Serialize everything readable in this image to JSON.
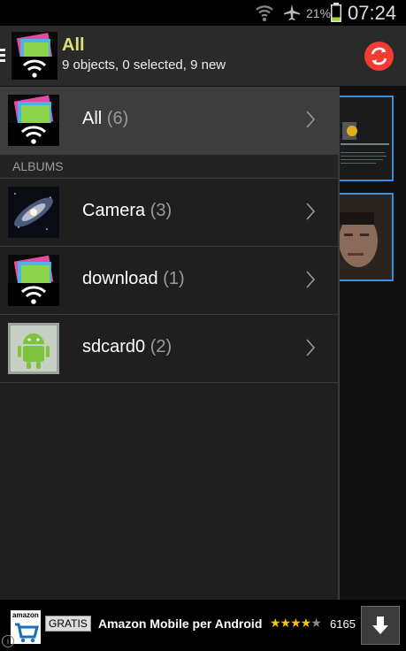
{
  "status_bar": {
    "battery_text": "21%",
    "time": "07:24"
  },
  "action_bar": {
    "title": "All",
    "subtitle": "9 objects, 0 selected, 9 new",
    "refresh_color": "#f23b32"
  },
  "drawer": {
    "all_item": {
      "label": "All",
      "count": "(6)"
    },
    "section_header": "ALBUMS",
    "albums": [
      {
        "label": "Camera",
        "count": "(3)",
        "icon": "galaxy-photo-icon"
      },
      {
        "label": "download",
        "count": "(1)",
        "icon": "photo-wifi-app-icon"
      },
      {
        "label": "sdcard0",
        "count": "(2)",
        "icon": "android-robot-icon"
      }
    ]
  },
  "ad": {
    "brand": "amazon",
    "badge": "GRATIS",
    "title": "Amazon Mobile per Android",
    "rating": 4,
    "rating_max": 5,
    "count": "6165",
    "info": "i"
  },
  "colors": {
    "accent_title": "#dede7a",
    "selection_border": "#3a8fd6"
  }
}
